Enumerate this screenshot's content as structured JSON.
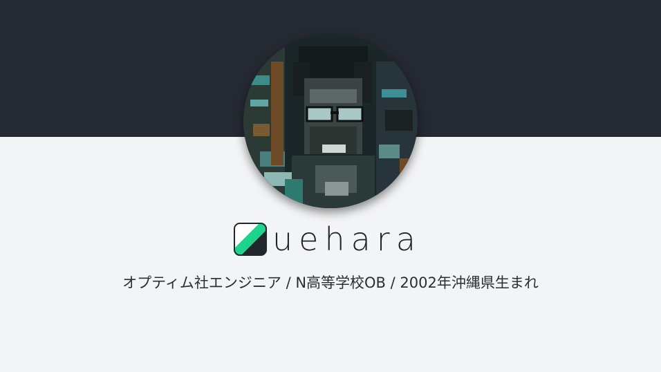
{
  "profile": {
    "name": "uehara",
    "bio": "オプティム社エンジニア / N高等学校OB / 2002年沖縄県生まれ",
    "logo_icon": "slash-logo-icon",
    "avatar_icon": "profile-photo"
  },
  "colors": {
    "header_background": "#252932",
    "page_background": "#f3f4f6",
    "logo_accent": "#1fd38a",
    "logo_dark": "#22262d",
    "text": "#1f2329"
  }
}
